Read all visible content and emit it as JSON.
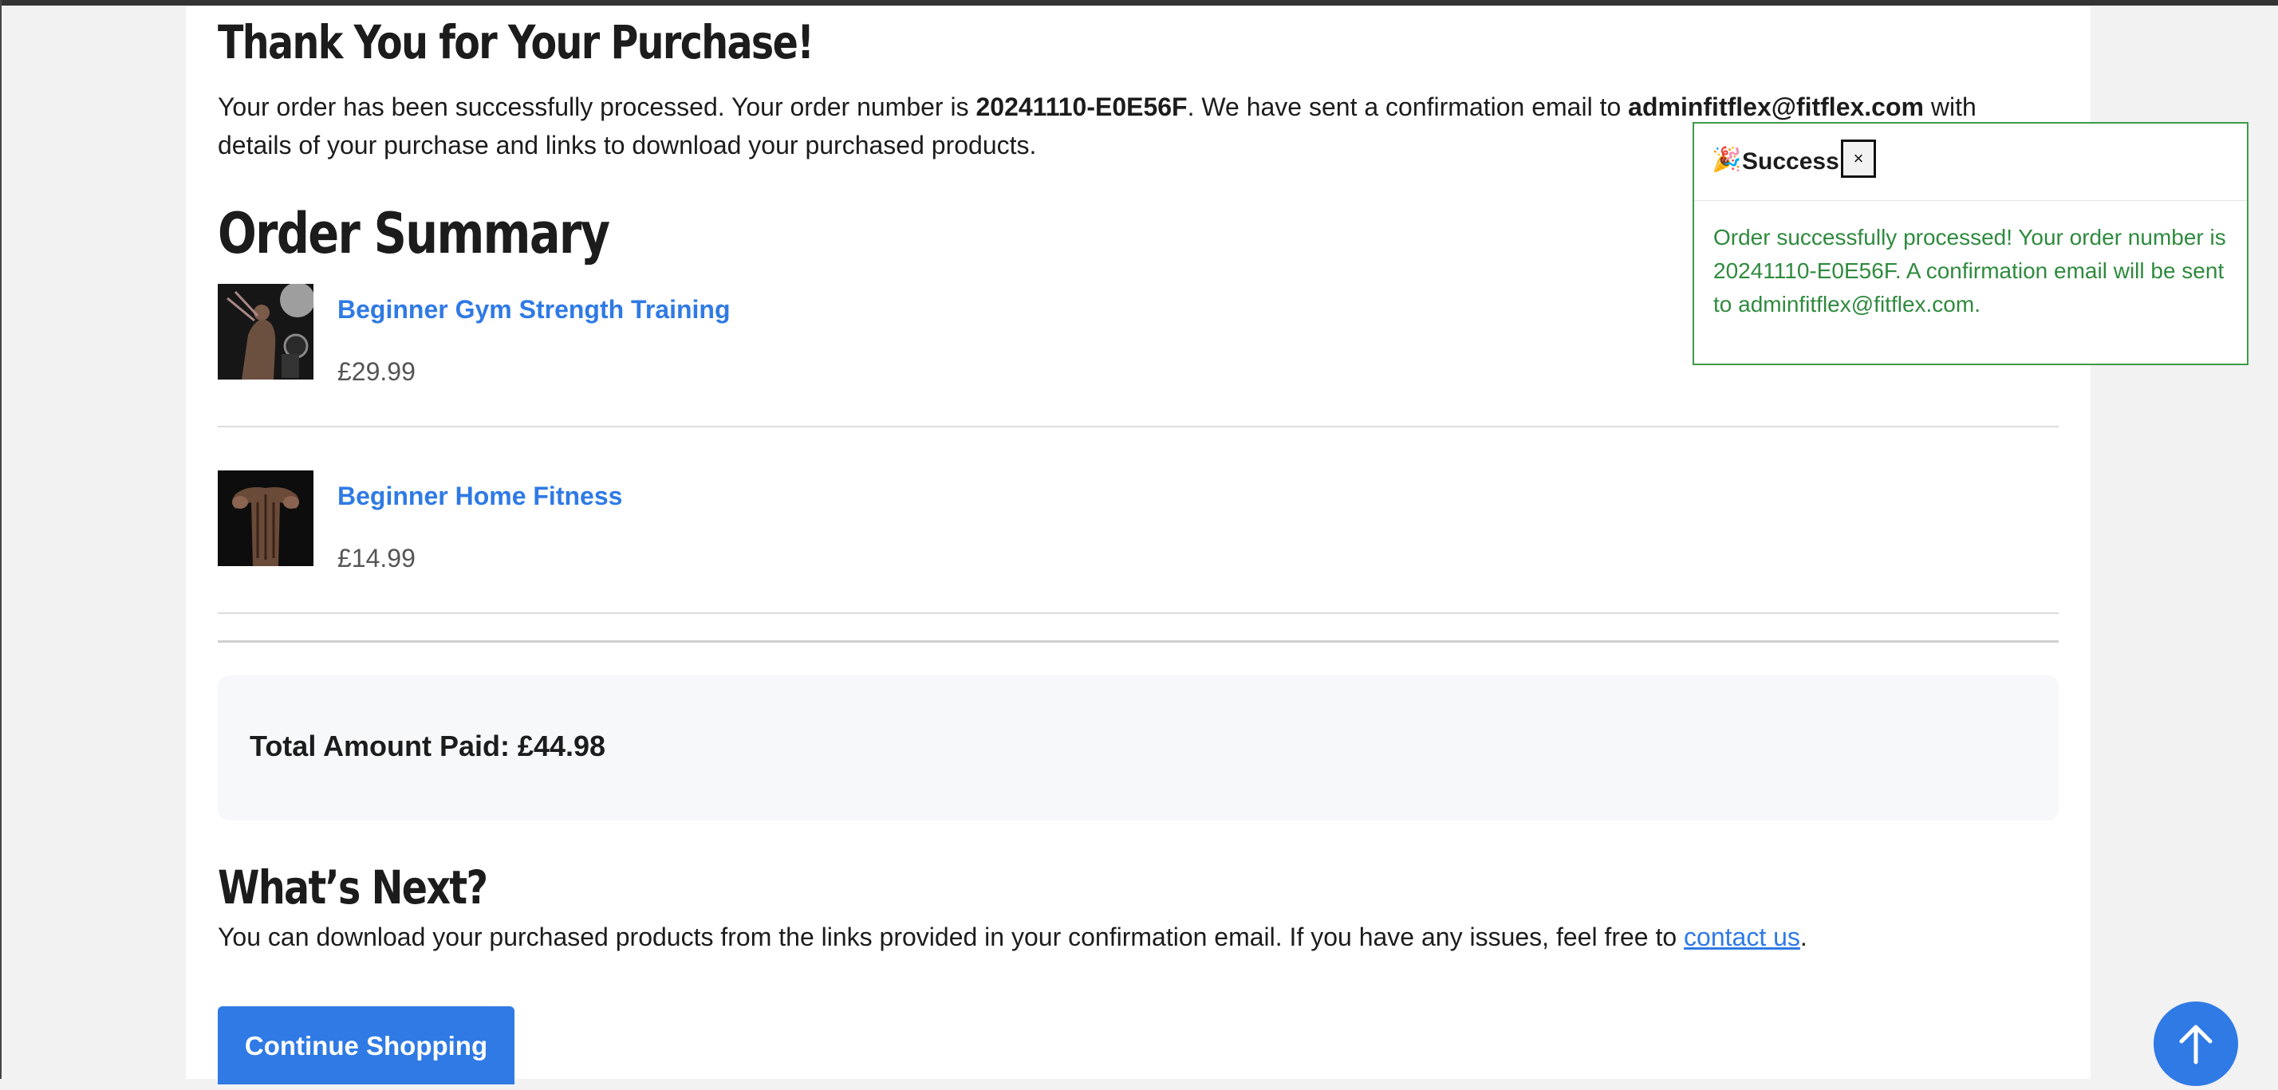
{
  "page": {
    "title": "Thank You for Your Purchase!",
    "intro_a": "Your order has been successfully processed. Your order number is ",
    "order_number": "20241110-E0E56F",
    "intro_b": ". We have sent a confirmation email to ",
    "email": "adminfitflex@fitflex.com",
    "intro_c": " with details of your purchase and links to download your purchased products."
  },
  "summary": {
    "title": "Order Summary",
    "items": [
      {
        "name": "Beginner Gym Strength Training",
        "price": "£29.99"
      },
      {
        "name": "Beginner Home Fitness",
        "price": "£14.99"
      }
    ],
    "total_label": "Total Amount Paid: £44.98"
  },
  "next": {
    "title": "What’s Next?",
    "text_before": "You can download your purchased products from the links provided in your confirmation email. If you have any issues, feel free to ",
    "link": "contact us",
    "text_after": "."
  },
  "continue_button": "Continue Shopping",
  "toast": {
    "emoji": "🎉",
    "title": "Success!",
    "close": "×",
    "message": "Order successfully processed! Your order number is 20241110-E0E56F. A confirmation email will be sent to adminfitflex@fitflex.com."
  },
  "icons": {
    "scroll_top": "arrow-up-icon"
  },
  "colors": {
    "accent": "#2f7ae5",
    "success": "#3c9a47"
  }
}
